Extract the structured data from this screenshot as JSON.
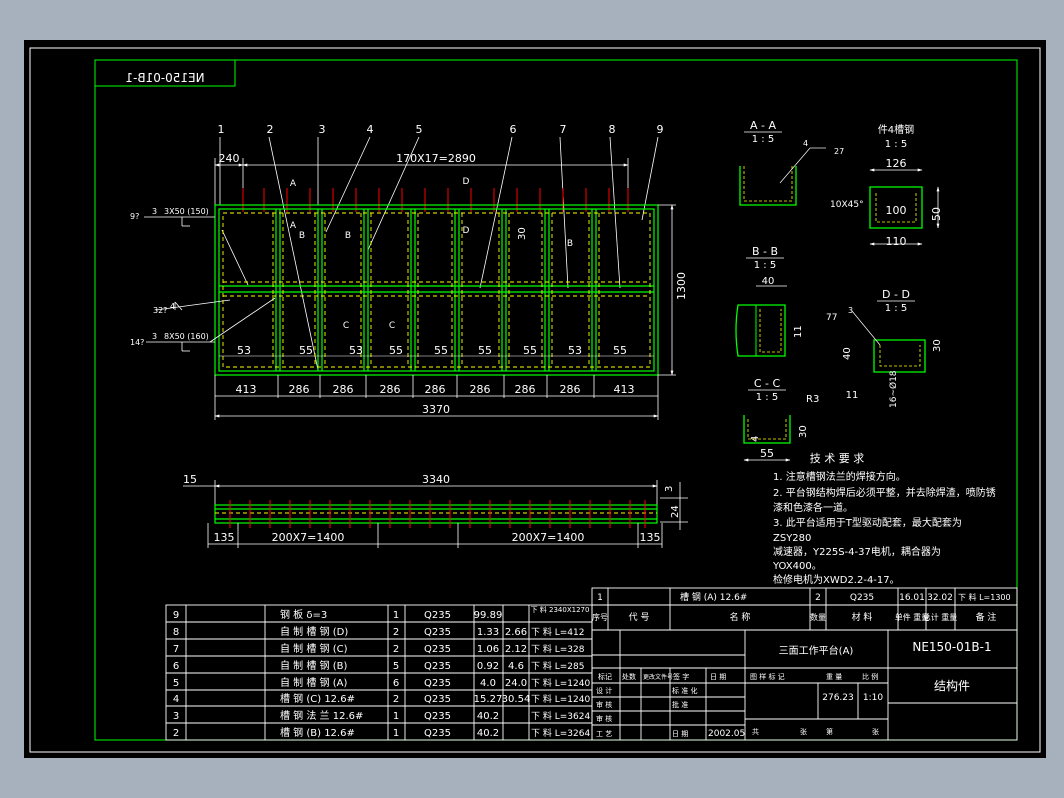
{
  "drawing": {
    "title_stamp": "NE150-01B-1",
    "views": {
      "plan": {
        "callouts": [
          "1",
          "2",
          "3",
          "4",
          "5",
          "6",
          "7",
          "8",
          "9"
        ],
        "top_dims": {
          "left": "240",
          "pitch": "170X17=2890"
        },
        "section_marks": {
          "a1": "A",
          "a2": "A",
          "b1": "B",
          "b2": "B",
          "b3": "B",
          "c1": "C",
          "c2": "C",
          "d1": "D",
          "d2": "D"
        },
        "inner_dim": "30",
        "height_dim": "1300",
        "cell_dims": [
          "53",
          "55",
          "53",
          "55",
          "55",
          "55",
          "55",
          "53",
          "55"
        ],
        "bottom_dims": [
          "413",
          "286",
          "286",
          "286",
          "286",
          "286",
          "286",
          "286",
          "413"
        ],
        "total_width": "3370",
        "welds": {
          "w1_left": "9?",
          "w1_sym": "3",
          "w1_text": "3X50 (150)",
          "w2_left": "32?",
          "w2_sym": "4",
          "w3_left": "14?",
          "w3_sym": "3",
          "w3_text": "8X50 (160)"
        }
      },
      "elevation": {
        "left_dim": "15",
        "total_dim": "3340",
        "right_dim": "3",
        "height_dim": "24",
        "left_end": "135",
        "right_end": "135",
        "pitch_left": "200X7=1400",
        "pitch_right": "200X7=1400"
      },
      "section_aa": {
        "title": "A - A",
        "scale": "1 : 5",
        "weld_sym": "4",
        "weld_val": "27"
      },
      "section_bb": {
        "title": "B - B",
        "scale": "1 : 5",
        "d_top": "40",
        "d_side": "11"
      },
      "section_cc": {
        "title": "C - C",
        "scale": "1 : 5",
        "radius": "R3",
        "d_side": "30",
        "d_left": "4",
        "d_bottom": "55"
      },
      "section_dd": {
        "title": "D - D",
        "scale": "1 : 5",
        "weld_sym": "3",
        "weld_val": "77",
        "d_h1": "40",
        "d_h2": "30",
        "d_bottom": "11",
        "d_side": "16~Ø18"
      },
      "detail_4": {
        "title": "件4槽钢",
        "scale": "1 : 5",
        "d_top": "126",
        "chamfer": "10X45°",
        "d_inner": "100",
        "d_h": "50",
        "d_bottom": "110"
      }
    },
    "notes": {
      "title": "技 术 要 求",
      "lines": [
        "1. 注意槽钢法兰的焊接方向。",
        "2. 平台钢结构焊后必须平整，并去除焊渣，喷防锈",
        "漆和色漆各一道。",
        "3. 此平台适用于T型驱动配套，最大配套为",
        "ZSY280",
        "减速器，Y225S-4-37电机，耦合器为",
        "YOX400。",
        "检修电机为XWD2.2-4-17。"
      ]
    },
    "bom": {
      "rows": [
        {
          "no": "9",
          "code": "",
          "name": "钢 板 δ=3",
          "qty": "1",
          "mat": "Q235",
          "w1": "99.89",
          "w2": "",
          "note": "下 料 2340X1270"
        },
        {
          "no": "8",
          "code": "",
          "name": "自 制 槽 钢 (D)",
          "qty": "2",
          "mat": "Q235",
          "w1": "1.33",
          "w2": "2.66",
          "note": "下 料 L=412"
        },
        {
          "no": "7",
          "code": "",
          "name": "自 制 槽 钢 (C)",
          "qty": "2",
          "mat": "Q235",
          "w1": "1.06",
          "w2": "2.12",
          "note": "下 料 L=328"
        },
        {
          "no": "6",
          "code": "",
          "name": "自 制 槽 钢 (B)",
          "qty": "5",
          "mat": "Q235",
          "w1": "0.92",
          "w2": "4.6",
          "note": "下 料 L=285"
        },
        {
          "no": "5",
          "code": "",
          "name": "自 制 槽 钢 (A)",
          "qty": "6",
          "mat": "Q235",
          "w1": "4.0",
          "w2": "24.0",
          "note": "下 料 L=1240"
        },
        {
          "no": "4",
          "code": "",
          "name": "槽 钢 (C)  12.6#",
          "qty": "2",
          "mat": "Q235",
          "w1": "15.27",
          "w2": "30.54",
          "note": "下 料 L=1240"
        },
        {
          "no": "3",
          "code": "",
          "name": "槽 钢 法 兰  12.6#",
          "qty": "1",
          "mat": "Q235",
          "w1": "40.2",
          "w2": "",
          "note": "下 料 L=3624"
        },
        {
          "no": "2",
          "code": "",
          "name": "槽 钢 (B)  12.6#",
          "qty": "1",
          "mat": "Q235",
          "w1": "40.2",
          "w2": "",
          "note": "下 料 L=3264"
        }
      ],
      "row1": {
        "no": "1",
        "name": "槽 钢 (A)  12.6#",
        "qty": "2",
        "mat": "Q235",
        "w1": "16.01",
        "w2": "32.02",
        "note": "下 料 L=1300"
      },
      "header": {
        "no": "序号",
        "code": "代 号",
        "name": "名 称",
        "qty": "数量",
        "mat": "材 料",
        "w1": "单件 重量",
        "w2": "总计 重量",
        "note": "备 注"
      }
    },
    "title_block": {
      "project": "三面工作平台(A)",
      "drawing_no": "NE150-01B-1",
      "part_type": "结构件",
      "weight": "276.23",
      "scale": "1:10",
      "date": "2002.05",
      "labels": {
        "mark": "标记",
        "count": "处数",
        "file": "更改文件号",
        "sign": "签 字",
        "date": "日 期",
        "design": "设 计",
        "std": "标 准 化",
        "check": "审 核",
        "approve": "批 准",
        "process": "工 艺",
        "stage": "图 样 标 记",
        "weight_lbl": "重 量",
        "scale_lbl": "比 例",
        "total": "共",
        "sheet_lbl": "张",
        "page": "第",
        "sheet2": "张",
        "date_lbl": "日 期"
      }
    }
  }
}
